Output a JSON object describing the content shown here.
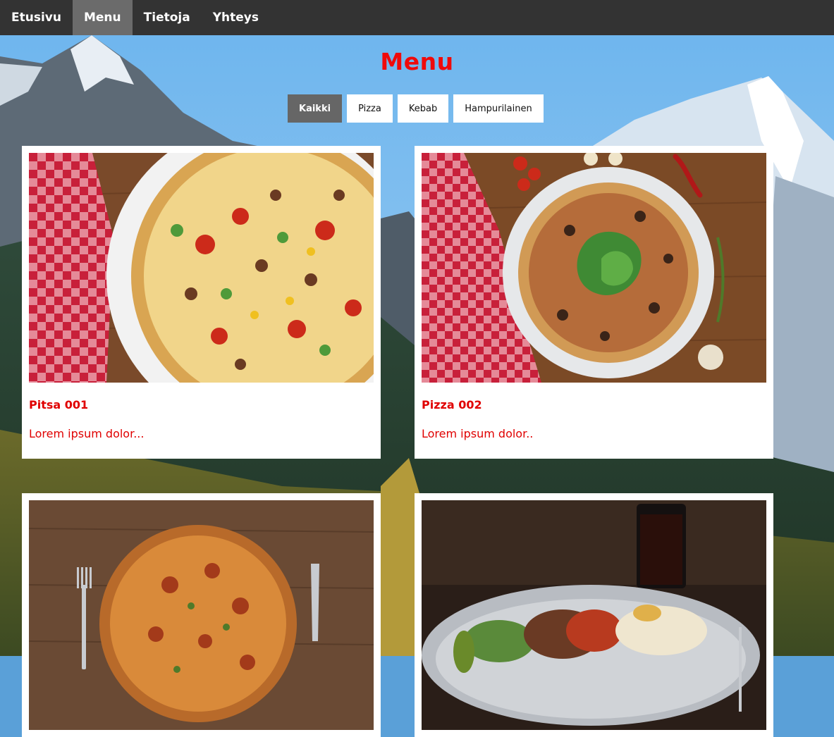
{
  "nav": {
    "items": [
      {
        "label": "Etusivu",
        "active": false
      },
      {
        "label": "Menu",
        "active": true
      },
      {
        "label": "Tietoja",
        "active": false
      },
      {
        "label": "Yhteys",
        "active": false
      }
    ]
  },
  "page": {
    "title": "Menu"
  },
  "filters": [
    {
      "label": "Kaikki",
      "active": true
    },
    {
      "label": "Pizza",
      "active": false
    },
    {
      "label": "Kebab",
      "active": false
    },
    {
      "label": "Hampurilainen",
      "active": false
    }
  ],
  "menu_items": [
    {
      "title": "Pitsa 001",
      "description": "Lorem ipsum dolor..."
    },
    {
      "title": "Pizza 002",
      "description": "Lorem ipsum dolor.."
    },
    {
      "title": "",
      "description": ""
    },
    {
      "title": "",
      "description": ""
    }
  ],
  "colors": {
    "nav_bg": "#333333",
    "nav_active": "#6b6b6b",
    "accent_red": "#e00000",
    "filter_active": "#666666"
  }
}
